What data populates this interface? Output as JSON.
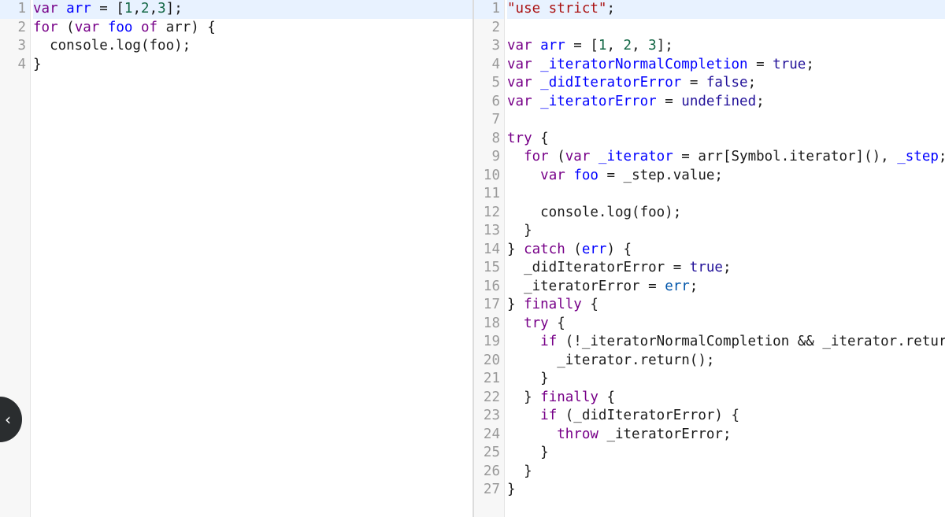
{
  "colors": {
    "keyword": "#770088",
    "definition": "#0000ff",
    "number": "#116644",
    "string": "#aa1111",
    "atom": "#221199",
    "variable2": "#0055aa",
    "active_line": "#e8f2ff"
  },
  "collapse_button": {
    "icon": "chevron-left-icon",
    "glyph": "‹"
  },
  "input_editor": {
    "lines": [
      {
        "num": "1",
        "tokens": [
          {
            "t": "var",
            "c": "kw"
          },
          {
            "t": " ",
            "c": "plain"
          },
          {
            "t": "arr",
            "c": "def"
          },
          {
            "t": " = [",
            "c": "plain"
          },
          {
            "t": "1",
            "c": "num"
          },
          {
            "t": ",",
            "c": "plain"
          },
          {
            "t": "2",
            "c": "num"
          },
          {
            "t": ",",
            "c": "plain"
          },
          {
            "t": "3",
            "c": "num"
          },
          {
            "t": "];",
            "c": "plain"
          }
        ]
      },
      {
        "num": "2",
        "tokens": [
          {
            "t": "for",
            "c": "kw"
          },
          {
            "t": " (",
            "c": "plain"
          },
          {
            "t": "var",
            "c": "kw"
          },
          {
            "t": " ",
            "c": "plain"
          },
          {
            "t": "foo",
            "c": "def"
          },
          {
            "t": " ",
            "c": "plain"
          },
          {
            "t": "of",
            "c": "kw"
          },
          {
            "t": " arr) {",
            "c": "plain"
          }
        ]
      },
      {
        "num": "3",
        "tokens": [
          {
            "t": "  console.log(foo);",
            "c": "plain"
          }
        ]
      },
      {
        "num": "4",
        "tokens": [
          {
            "t": "}",
            "c": "plain"
          }
        ]
      }
    ]
  },
  "output_editor": {
    "lines": [
      {
        "num": "1",
        "tokens": [
          {
            "t": "\"use strict\"",
            "c": "str"
          },
          {
            "t": ";",
            "c": "plain"
          }
        ]
      },
      {
        "num": "2",
        "tokens": []
      },
      {
        "num": "3",
        "tokens": [
          {
            "t": "var",
            "c": "kw"
          },
          {
            "t": " ",
            "c": "plain"
          },
          {
            "t": "arr",
            "c": "def"
          },
          {
            "t": " = [",
            "c": "plain"
          },
          {
            "t": "1",
            "c": "num"
          },
          {
            "t": ", ",
            "c": "plain"
          },
          {
            "t": "2",
            "c": "num"
          },
          {
            "t": ", ",
            "c": "plain"
          },
          {
            "t": "3",
            "c": "num"
          },
          {
            "t": "];",
            "c": "plain"
          }
        ]
      },
      {
        "num": "4",
        "tokens": [
          {
            "t": "var",
            "c": "kw"
          },
          {
            "t": " ",
            "c": "plain"
          },
          {
            "t": "_iteratorNormalCompletion",
            "c": "def"
          },
          {
            "t": " = ",
            "c": "plain"
          },
          {
            "t": "true",
            "c": "atom"
          },
          {
            "t": ";",
            "c": "plain"
          }
        ]
      },
      {
        "num": "5",
        "tokens": [
          {
            "t": "var",
            "c": "kw"
          },
          {
            "t": " ",
            "c": "plain"
          },
          {
            "t": "_didIteratorError",
            "c": "def"
          },
          {
            "t": " = ",
            "c": "plain"
          },
          {
            "t": "false",
            "c": "atom"
          },
          {
            "t": ";",
            "c": "plain"
          }
        ]
      },
      {
        "num": "6",
        "tokens": [
          {
            "t": "var",
            "c": "kw"
          },
          {
            "t": " ",
            "c": "plain"
          },
          {
            "t": "_iteratorError",
            "c": "def"
          },
          {
            "t": " = ",
            "c": "plain"
          },
          {
            "t": "undefined",
            "c": "atom"
          },
          {
            "t": ";",
            "c": "plain"
          }
        ]
      },
      {
        "num": "7",
        "tokens": []
      },
      {
        "num": "8",
        "tokens": [
          {
            "t": "try",
            "c": "kw"
          },
          {
            "t": " {",
            "c": "plain"
          }
        ]
      },
      {
        "num": "9",
        "tokens": [
          {
            "t": "  ",
            "c": "plain"
          },
          {
            "t": "for",
            "c": "kw"
          },
          {
            "t": " (",
            "c": "plain"
          },
          {
            "t": "var",
            "c": "kw"
          },
          {
            "t": " ",
            "c": "plain"
          },
          {
            "t": "_iterator",
            "c": "def"
          },
          {
            "t": " = arr[Symbol.iterator](), ",
            "c": "plain"
          },
          {
            "t": "_step",
            "c": "def"
          },
          {
            "t": ";",
            "c": "plain"
          }
        ]
      },
      {
        "num": "10",
        "tokens": [
          {
            "t": "    ",
            "c": "plain"
          },
          {
            "t": "var",
            "c": "kw"
          },
          {
            "t": " ",
            "c": "plain"
          },
          {
            "t": "foo",
            "c": "def"
          },
          {
            "t": " = _step.value;",
            "c": "plain"
          }
        ]
      },
      {
        "num": "11",
        "tokens": []
      },
      {
        "num": "12",
        "tokens": [
          {
            "t": "    console.log(foo);",
            "c": "plain"
          }
        ]
      },
      {
        "num": "13",
        "tokens": [
          {
            "t": "  }",
            "c": "plain"
          }
        ]
      },
      {
        "num": "14",
        "tokens": [
          {
            "t": "} ",
            "c": "plain"
          },
          {
            "t": "catch",
            "c": "kw"
          },
          {
            "t": " (",
            "c": "plain"
          },
          {
            "t": "err",
            "c": "def"
          },
          {
            "t": ") {",
            "c": "plain"
          }
        ]
      },
      {
        "num": "15",
        "tokens": [
          {
            "t": "  _didIteratorError = ",
            "c": "plain"
          },
          {
            "t": "true",
            "c": "atom"
          },
          {
            "t": ";",
            "c": "plain"
          }
        ]
      },
      {
        "num": "16",
        "tokens": [
          {
            "t": "  _iteratorError = ",
            "c": "plain"
          },
          {
            "t": "err",
            "c": "var2"
          },
          {
            "t": ";",
            "c": "plain"
          }
        ]
      },
      {
        "num": "17",
        "tokens": [
          {
            "t": "} ",
            "c": "plain"
          },
          {
            "t": "finally",
            "c": "kw"
          },
          {
            "t": " {",
            "c": "plain"
          }
        ]
      },
      {
        "num": "18",
        "tokens": [
          {
            "t": "  ",
            "c": "plain"
          },
          {
            "t": "try",
            "c": "kw"
          },
          {
            "t": " {",
            "c": "plain"
          }
        ]
      },
      {
        "num": "19",
        "tokens": [
          {
            "t": "    ",
            "c": "plain"
          },
          {
            "t": "if",
            "c": "kw"
          },
          {
            "t": " (!_iteratorNormalCompletion && _iterator.return",
            "c": "plain"
          }
        ]
      },
      {
        "num": "20",
        "tokens": [
          {
            "t": "      _iterator.return();",
            "c": "plain"
          }
        ]
      },
      {
        "num": "21",
        "tokens": [
          {
            "t": "    }",
            "c": "plain"
          }
        ]
      },
      {
        "num": "22",
        "tokens": [
          {
            "t": "  } ",
            "c": "plain"
          },
          {
            "t": "finally",
            "c": "kw"
          },
          {
            "t": " {",
            "c": "plain"
          }
        ]
      },
      {
        "num": "23",
        "tokens": [
          {
            "t": "    ",
            "c": "plain"
          },
          {
            "t": "if",
            "c": "kw"
          },
          {
            "t": " (_didIteratorError) {",
            "c": "plain"
          }
        ]
      },
      {
        "num": "24",
        "tokens": [
          {
            "t": "      ",
            "c": "plain"
          },
          {
            "t": "throw",
            "c": "kw"
          },
          {
            "t": " _iteratorError;",
            "c": "plain"
          }
        ]
      },
      {
        "num": "25",
        "tokens": [
          {
            "t": "    }",
            "c": "plain"
          }
        ]
      },
      {
        "num": "26",
        "tokens": [
          {
            "t": "  }",
            "c": "plain"
          }
        ]
      },
      {
        "num": "27",
        "tokens": [
          {
            "t": "}",
            "c": "plain"
          }
        ]
      }
    ]
  }
}
